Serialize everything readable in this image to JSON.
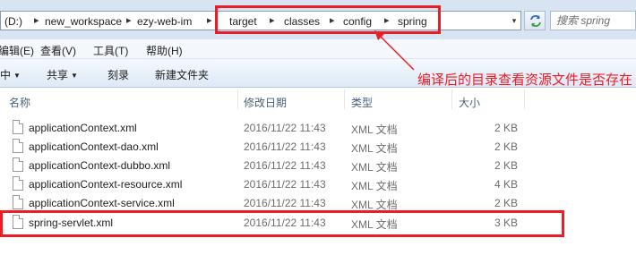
{
  "address_bar": {
    "crumbs": [
      "(D:)",
      "new_workspace",
      "ezy-web-im",
      "target",
      "classes",
      "config",
      "spring"
    ],
    "separator": "▸",
    "dropdown": "▾"
  },
  "search": {
    "placeholder": "搜索 spring"
  },
  "menubar": {
    "items": [
      "编辑(E)",
      "查看(V)",
      "工具(T)",
      "帮助(H)"
    ]
  },
  "commandbar": {
    "items": [
      {
        "label": "中",
        "caret": true
      },
      {
        "label": "共享",
        "caret": true
      },
      {
        "label": "刻录",
        "caret": false
      },
      {
        "label": "新建文件夹",
        "caret": false
      }
    ]
  },
  "columns": {
    "name": "名称",
    "date": "修改日期",
    "type": "类型",
    "size": "大小"
  },
  "files": [
    {
      "name": "applicationContext.xml",
      "date": "2016/11/22 11:43",
      "type": "XML 文档",
      "size": "2 KB"
    },
    {
      "name": "applicationContext-dao.xml",
      "date": "2016/11/22 11:43",
      "type": "XML 文档",
      "size": "2 KB"
    },
    {
      "name": "applicationContext-dubbo.xml",
      "date": "2016/11/22 11:43",
      "type": "XML 文档",
      "size": "2 KB"
    },
    {
      "name": "applicationContext-resource.xml",
      "date": "2016/11/22 11:43",
      "type": "XML 文档",
      "size": "4 KB"
    },
    {
      "name": "applicationContext-service.xml",
      "date": "2016/11/22 11:43",
      "type": "XML 文档",
      "size": "2 KB"
    },
    {
      "name": "spring-servlet.xml",
      "date": "2016/11/22 11:43",
      "type": "XML 文档",
      "size": "3 KB"
    }
  ],
  "annotation": {
    "text": "编译后的目录查看资源文件是否存在",
    "color": "#ee1c25"
  },
  "icons": {
    "refresh": "refresh-icon",
    "file": "file-icon",
    "arrow": "arrow-icon"
  }
}
